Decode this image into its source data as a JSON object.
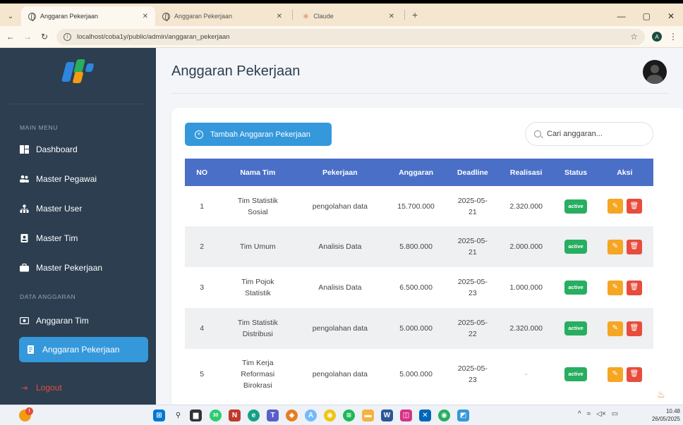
{
  "browser": {
    "tabs": [
      {
        "title": "Anggaran Pekerjaan",
        "active": true
      },
      {
        "title": "Anggaran Pekerjaan",
        "active": false
      },
      {
        "title": "Claude",
        "active": false
      }
    ],
    "url": "localhost/coba1y/public/admin/anggaran_pekerjaan",
    "profile_initial": "A"
  },
  "sidebar": {
    "main_menu_label": "MAIN MENU",
    "items": [
      {
        "label": "Dashboard",
        "icon": "dashboard-icon"
      },
      {
        "label": "Master Pegawai",
        "icon": "users-icon"
      },
      {
        "label": "Master User",
        "icon": "user-tree-icon"
      },
      {
        "label": "Master Tim",
        "icon": "id-card-icon"
      },
      {
        "label": "Master Pekerjaan",
        "icon": "briefcase-icon"
      }
    ],
    "data_label": "DATA ANGGARAN",
    "data_items": [
      {
        "label": "Anggaran Tim",
        "icon": "money-icon"
      },
      {
        "label": "Anggaran Pekerjaan",
        "icon": "receipt-icon",
        "active": true
      }
    ],
    "logout_label": "Logout"
  },
  "page": {
    "title": "Anggaran Pekerjaan",
    "add_button_label": "Tambah Anggaran Pekerjaan",
    "search_placeholder": "Cari anggaran..."
  },
  "table": {
    "headers": [
      "NO",
      "Nama Tim",
      "Pekerjaan",
      "Anggaran",
      "Deadline",
      "Realisasi",
      "Status",
      "Aksi"
    ],
    "rows": [
      {
        "no": "1",
        "nama_tim": [
          "Tim Statistik",
          "Sosial"
        ],
        "pekerjaan": "pengolahan data",
        "anggaran": "15.700.000",
        "deadline": [
          "2025-05-",
          "21"
        ],
        "realisasi": "2.320.000",
        "status": "active"
      },
      {
        "no": "2",
        "nama_tim": [
          "Tim Umum"
        ],
        "pekerjaan": "Analisis Data",
        "anggaran": "5.800.000",
        "deadline": [
          "2025-05-",
          "21"
        ],
        "realisasi": "2.000.000",
        "status": "active"
      },
      {
        "no": "3",
        "nama_tim": [
          "Tim Pojok",
          "Statistik"
        ],
        "pekerjaan": "Analisis Data",
        "anggaran": "6.500.000",
        "deadline": [
          "2025-05-",
          "23"
        ],
        "realisasi": "1.000.000",
        "status": "active"
      },
      {
        "no": "4",
        "nama_tim": [
          "Tim Statistik",
          "Distribusi"
        ],
        "pekerjaan": "pengolahan data",
        "anggaran": "5.000.000",
        "deadline": [
          "2025-05-",
          "22"
        ],
        "realisasi": "2.320.000",
        "status": "active"
      },
      {
        "no": "5",
        "nama_tim": [
          "Tim Kerja",
          "Reformasi",
          "Birokrasi"
        ],
        "pekerjaan": "pengolahan data",
        "anggaran": "5.000.000",
        "deadline": [
          "2025-05-",
          "23"
        ],
        "realisasi": "-",
        "status": "active"
      }
    ]
  },
  "taskbar": {
    "time": "10.48",
    "date": "26/05/2025",
    "notification_count": "30"
  },
  "colors": {
    "sidebar_bg": "#2c3e50",
    "accent": "#3498db",
    "table_header": "#4a6fc7",
    "status_active": "#27ae60",
    "edit": "#f5a623",
    "delete": "#e74c3c"
  }
}
